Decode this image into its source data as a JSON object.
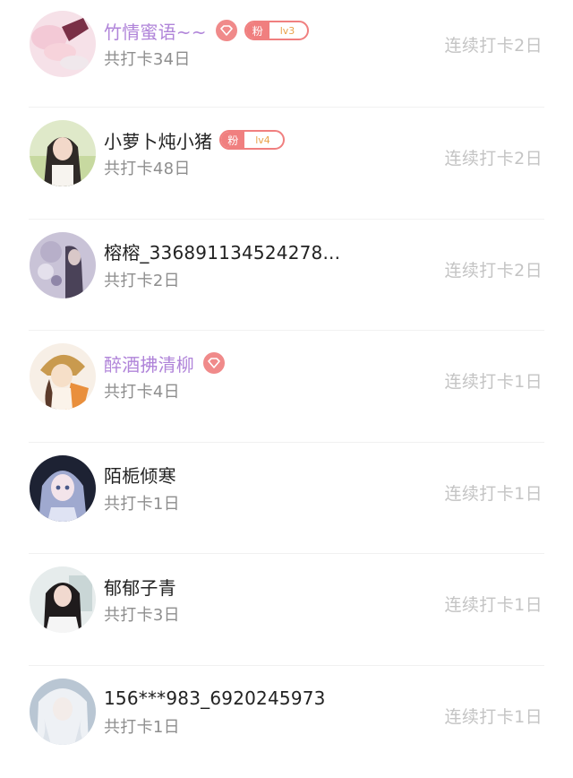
{
  "checkin_list": [
    {
      "name": "竹情蜜语~~",
      "vip": true,
      "diamond_icon": "diamond-icon",
      "fan_badge": {
        "label": "粉",
        "level": "lv3"
      },
      "total": "共打卡34日",
      "streak": "连续打卡2日",
      "avatar_icon": "avatar-hand-photo"
    },
    {
      "name": "小萝卜炖小猪",
      "vip": false,
      "fan_badge": {
        "label": "粉",
        "level": "lv4"
      },
      "total": "共打卡48日",
      "streak": "连续打卡2日",
      "avatar_icon": "avatar-girl-photo"
    },
    {
      "name": "榕榕_336891134524278...",
      "vip": false,
      "total": "共打卡2日",
      "streak": "连续打卡2日",
      "avatar_icon": "avatar-illustration"
    },
    {
      "name": "醉酒拂清柳",
      "vip": true,
      "diamond_icon": "diamond-icon",
      "total": "共打卡4日",
      "streak": "连续打卡1日",
      "avatar_icon": "avatar-anime-girl"
    },
    {
      "name": "陌栀倾寒",
      "vip": false,
      "total": "共打卡1日",
      "streak": "连续打卡1日",
      "avatar_icon": "avatar-anime-portrait"
    },
    {
      "name": "郁郁子青",
      "vip": false,
      "total": "共打卡3日",
      "streak": "连续打卡1日",
      "avatar_icon": "avatar-girl-photo"
    },
    {
      "name": "156***983_6920245973",
      "vip": false,
      "total": "共打卡1日",
      "streak": "连续打卡1日",
      "avatar_icon": "avatar-illustration"
    }
  ],
  "colors": {
    "vip_name": "#b084d9",
    "normal_name": "#222222",
    "badge": "#f07f7f",
    "muted": "#8e8e8e",
    "streak": "#c4c4c4"
  }
}
